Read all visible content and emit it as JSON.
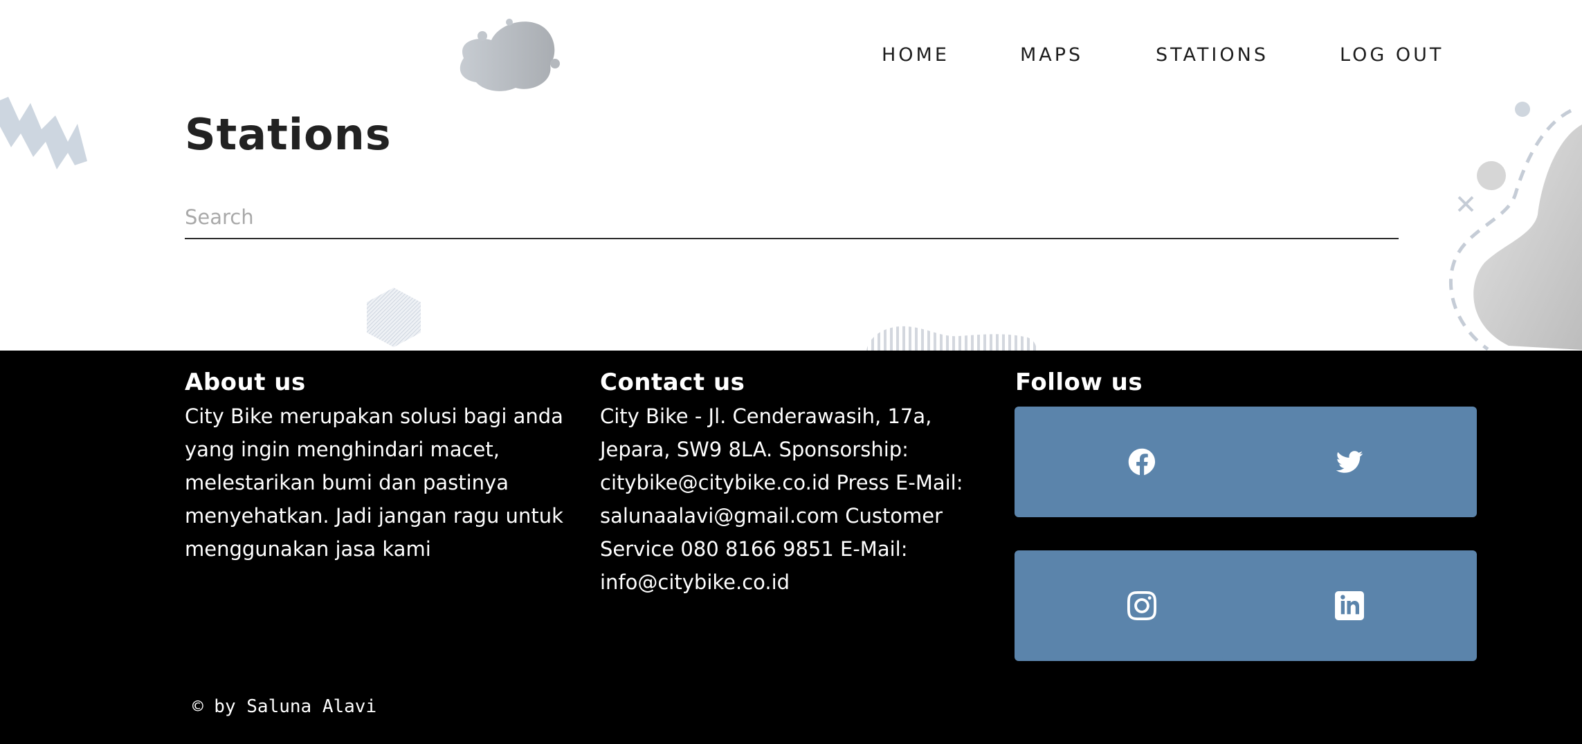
{
  "nav": {
    "items": [
      {
        "label": "HOME"
      },
      {
        "label": "MAPS"
      },
      {
        "label": "STATIONS"
      },
      {
        "label": "LOG OUT"
      }
    ]
  },
  "page": {
    "title": "Stations",
    "search_placeholder": "Search"
  },
  "footer": {
    "about": {
      "title": "About us",
      "text": "City Bike merupakan solusi bagi anda yang ingin menghindari macet, melestarikan bumi dan pastinya menyehatkan. Jadi jangan ragu untuk menggunakan jasa kami"
    },
    "contact": {
      "title": "Contact us",
      "text": "City Bike - Jl. Cenderawasih, 17a, Jepara, SW9 8LA. Sponsorship: citybike@citybike.co.id Press E-Mail: salunaalavi@gmail.com Customer Service 080 8166 9851 E-Mail: info@citybike.co.id"
    },
    "follow": {
      "title": "Follow us",
      "buttons": [
        {
          "icon": "facebook-icon"
        },
        {
          "icon": "twitter-icon"
        },
        {
          "icon": "instagram-icon"
        },
        {
          "icon": "linkedin-icon"
        }
      ]
    },
    "copyright": "© by Saluna Alavi"
  },
  "colors": {
    "footer_bg": "#000000",
    "social_button": "#5b84ab",
    "accent_decor": "#c9d3dd"
  }
}
